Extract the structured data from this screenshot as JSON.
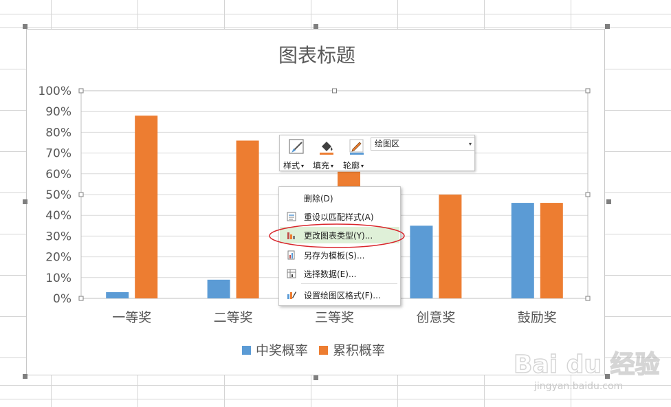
{
  "chart_data": {
    "type": "bar",
    "title": "图表标题",
    "categories": [
      "一等奖",
      "二等奖",
      "三等奖",
      "创意奖",
      "鼓励奖"
    ],
    "series": [
      {
        "name": "中奖概率",
        "color": "#5b9bd5",
        "values": [
          0.03,
          0.09,
          null,
          0.35,
          0.46
        ]
      },
      {
        "name": "累积概率",
        "color": "#ed7d31",
        "values": [
          0.88,
          0.76,
          0.61,
          0.5,
          0.46
        ]
      }
    ],
    "y_ticks": [
      "0%",
      "10%",
      "20%",
      "30%",
      "40%",
      "50%",
      "60%",
      "70%",
      "80%",
      "90%",
      "100%"
    ],
    "ylim": [
      0,
      1
    ],
    "grid": true,
    "legend_position": "bottom"
  },
  "toolbar": {
    "style_label": "样式",
    "fill_label": "填充",
    "outline_label": "轮廓",
    "element_select_value": "绘图区",
    "fill_color": "#ed7d31",
    "outline_color": "#5b9bd5"
  },
  "context_menu": {
    "items": [
      {
        "label": "删除(D)",
        "icon": "none"
      },
      {
        "label": "重设以匹配样式(A)",
        "icon": "reset-style-icon"
      },
      {
        "label": "更改图表类型(Y)...",
        "icon": "change-chart-type-icon",
        "highlighted": true
      },
      {
        "label": "另存为模板(S)...",
        "icon": "save-template-icon"
      },
      {
        "label": "选择数据(E)...",
        "icon": "select-data-icon"
      },
      {
        "label": "设置绘图区格式(F)...",
        "icon": "format-plot-area-icon"
      }
    ]
  },
  "annotation": {
    "color": "#d9262c"
  },
  "watermark": {
    "brand": "Bai du 经验",
    "url": "jingyan.baidu.com"
  }
}
